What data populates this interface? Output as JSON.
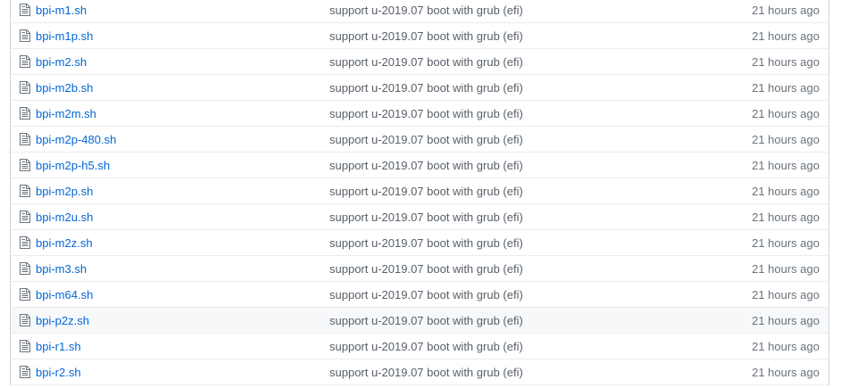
{
  "files": [
    {
      "icon": "file-icon",
      "name": "bpi-m1.sh",
      "message": "support u-2019.07 boot with grub (efi)",
      "age": "21 hours ago"
    },
    {
      "icon": "file-icon",
      "name": "bpi-m1p.sh",
      "message": "support u-2019.07 boot with grub (efi)",
      "age": "21 hours ago"
    },
    {
      "icon": "file-icon",
      "name": "bpi-m2.sh",
      "message": "support u-2019.07 boot with grub (efi)",
      "age": "21 hours ago"
    },
    {
      "icon": "file-icon",
      "name": "bpi-m2b.sh",
      "message": "support u-2019.07 boot with grub (efi)",
      "age": "21 hours ago"
    },
    {
      "icon": "file-icon",
      "name": "bpi-m2m.sh",
      "message": "support u-2019.07 boot with grub (efi)",
      "age": "21 hours ago"
    },
    {
      "icon": "file-icon",
      "name": "bpi-m2p-480.sh",
      "message": "support u-2019.07 boot with grub (efi)",
      "age": "21 hours ago"
    },
    {
      "icon": "file-icon",
      "name": "bpi-m2p-h5.sh",
      "message": "support u-2019.07 boot with grub (efi)",
      "age": "21 hours ago"
    },
    {
      "icon": "file-icon",
      "name": "bpi-m2p.sh",
      "message": "support u-2019.07 boot with grub (efi)",
      "age": "21 hours ago"
    },
    {
      "icon": "file-icon",
      "name": "bpi-m2u.sh",
      "message": "support u-2019.07 boot with grub (efi)",
      "age": "21 hours ago"
    },
    {
      "icon": "file-icon",
      "name": "bpi-m2z.sh",
      "message": "support u-2019.07 boot with grub (efi)",
      "age": "21 hours ago"
    },
    {
      "icon": "file-icon",
      "name": "bpi-m3.sh",
      "message": "support u-2019.07 boot with grub (efi)",
      "age": "21 hours ago"
    },
    {
      "icon": "file-icon",
      "name": "bpi-m64.sh",
      "message": "support u-2019.07 boot with grub (efi)",
      "age": "21 hours ago"
    },
    {
      "icon": "file-icon",
      "name": "bpi-p2z.sh",
      "message": "support u-2019.07 boot with grub (efi)",
      "age": "21 hours ago"
    },
    {
      "icon": "file-icon",
      "name": "bpi-r1.sh",
      "message": "support u-2019.07 boot with grub (efi)",
      "age": "21 hours ago"
    },
    {
      "icon": "file-icon",
      "name": "bpi-r2.sh",
      "message": "support u-2019.07 boot with grub (efi)",
      "age": "21 hours ago"
    }
  ],
  "hovered_row": 12,
  "colors": {
    "link": "#0366d6",
    "message": "#586069",
    "age": "#6a737d",
    "row_border": "#eaecef",
    "hover_bg": "#f6f8fa"
  }
}
